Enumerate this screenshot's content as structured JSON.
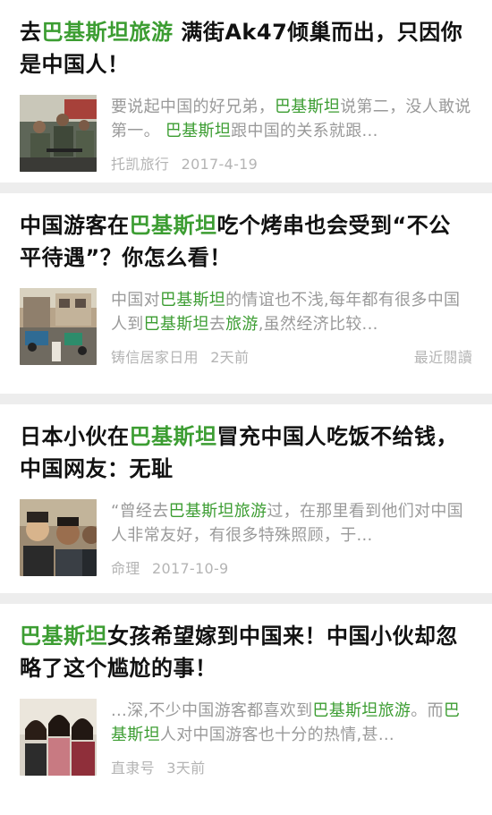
{
  "colors": {
    "highlight": "#3c9d32",
    "background": "#ededed",
    "card": "#ffffff"
  },
  "articles": [
    {
      "title": [
        {
          "t": "去",
          "h": false
        },
        {
          "t": "巴基斯坦旅游",
          "h": true
        },
        {
          "t": " 满街Ak47倾巢而出，只因你是中国人！",
          "h": false
        }
      ],
      "summary": [
        {
          "t": "要说起中国的好兄弟，",
          "h": false
        },
        {
          "t": "巴基斯坦",
          "h": true
        },
        {
          "t": "说第二，没人敢说第一。 ",
          "h": false
        },
        {
          "t": "巴基斯坦",
          "h": true
        },
        {
          "t": "跟中国的关系就跟...",
          "h": false
        }
      ],
      "source": "托凯旅行",
      "date": "2017-4-19",
      "tag": "",
      "thumb_icon": "soldiers-photo"
    },
    {
      "title": [
        {
          "t": "中国游客在",
          "h": false
        },
        {
          "t": "巴基斯坦",
          "h": true
        },
        {
          "t": "吃个烤串也会受到“不公平待遇”？你怎么看！",
          "h": false
        }
      ],
      "summary": [
        {
          "t": "中国对",
          "h": false
        },
        {
          "t": "巴基斯坦",
          "h": true
        },
        {
          "t": "的情谊也不浅,每年都有很多中国人到",
          "h": false
        },
        {
          "t": "巴基斯坦",
          "h": true
        },
        {
          "t": "去",
          "h": false
        },
        {
          "t": "旅游",
          "h": true
        },
        {
          "t": ",虽然经济比较...",
          "h": false
        }
      ],
      "source": "铸信居家日用",
      "date": "2天前",
      "tag": "最近閱讀",
      "thumb_icon": "street-photo"
    },
    {
      "title": [
        {
          "t": "日本小伙在",
          "h": false
        },
        {
          "t": "巴基斯坦",
          "h": true
        },
        {
          "t": "冒充中国人吃饭不给钱，中国网友：无耻",
          "h": false
        }
      ],
      "summary": [
        {
          "t": "“曾经去",
          "h": false
        },
        {
          "t": "巴基斯坦旅游",
          "h": true
        },
        {
          "t": "过，在那里看到他们对中国人非常友好，有很多特殊照顾，于...",
          "h": false
        }
      ],
      "source": "命理",
      "date": "2017-10-9",
      "tag": "",
      "thumb_icon": "men-selfie-photo"
    },
    {
      "title": [
        {
          "t": "巴基斯坦",
          "h": true
        },
        {
          "t": "女孩希望嫁到中国来！中国小伙却忽略了这个尴尬的事！",
          "h": false
        }
      ],
      "summary": [
        {
          "t": "...深,不少中国游客都喜欢到",
          "h": false
        },
        {
          "t": "巴基斯坦旅游",
          "h": true
        },
        {
          "t": "。而",
          "h": false
        },
        {
          "t": "巴基斯坦",
          "h": true
        },
        {
          "t": "人对中国游客也十分的热情,甚...",
          "h": false
        }
      ],
      "source": "直隶号",
      "date": "3天前",
      "tag": "",
      "thumb_icon": "women-group-photo"
    }
  ]
}
